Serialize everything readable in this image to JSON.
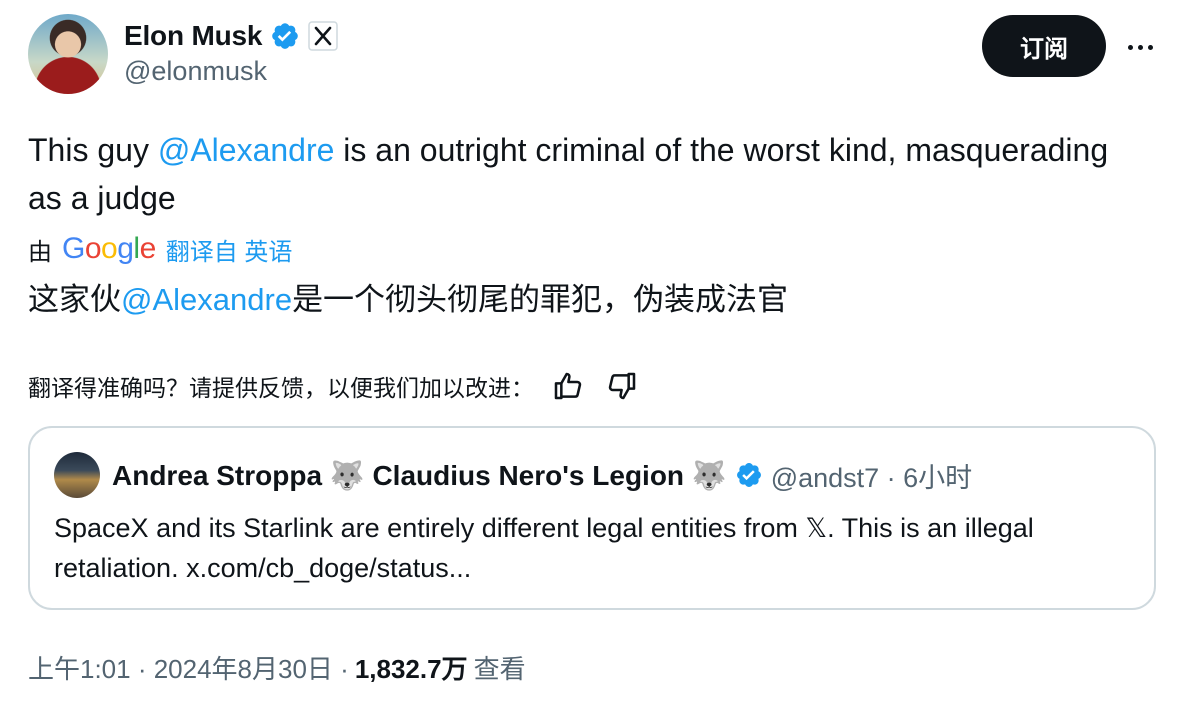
{
  "author": {
    "name": "Elon Musk",
    "handle": "@elonmusk",
    "verified_badge": "verified-badge-icon",
    "affiliate_badge": "x-logo-icon"
  },
  "actions": {
    "follow_label": "订阅",
    "more_icon": "more-dots-icon"
  },
  "tweet": {
    "text_before": "This guy ",
    "mention": "@Alexandre",
    "text_after": " is an outright criminal of the worst kind, masquerading as a judge"
  },
  "translation": {
    "by_label": "由",
    "provider_logo": "Google",
    "source_label": "翻译自 英语",
    "text_before": "这家伙",
    "mention": "@Alexandre",
    "text_after": "是一个彻头彻尾的罪犯，伪装成法官",
    "feedback_prompt": "翻译得准确吗？请提供反馈，以便我们加以改进：",
    "thumbs_up_icon": "thumbs-up-icon",
    "thumbs_down_icon": "thumbs-down-icon"
  },
  "quote": {
    "name": "Andrea Stroppa 🐺 Claudius Nero's Legion 🐺",
    "verified_badge": "verified-badge-icon",
    "handle_time": "@andst7 · 6小时",
    "text": "SpaceX and its Starlink are entirely different legal entities from 𝕏. This is an illegal retaliation. x.com/cb_doge/status..."
  },
  "meta": {
    "time_date": "上午1:01 · 2024年8月30日 ·",
    "views": "1,832.7万",
    "views_label": "查看"
  },
  "colors": {
    "accent": "#1d9bf0",
    "text": "#0f1419",
    "secondary": "#536471",
    "border": "#cfd9de"
  }
}
